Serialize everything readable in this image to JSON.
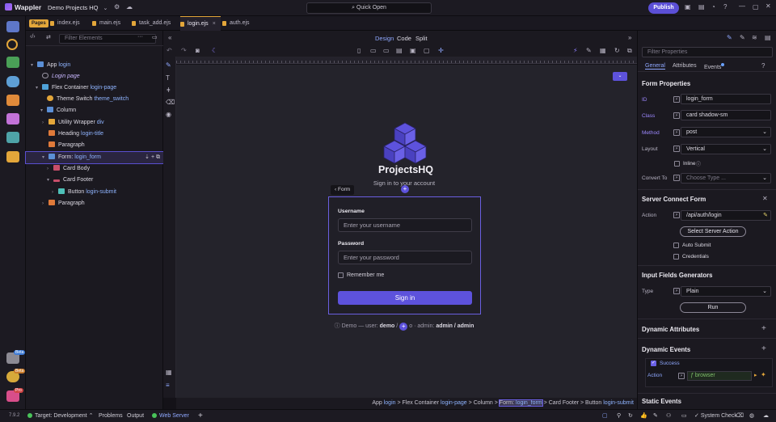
{
  "app": {
    "name": "Wappler",
    "project": "Demo Projects HQ",
    "quick_open": "Quick Open",
    "publish": "Publish"
  },
  "tabs": {
    "pages_badge": "Pages",
    "items": [
      "index.ejs",
      "main.ejs",
      "task_add.ejs",
      "login.ejs",
      "auth.ejs"
    ],
    "active": "login.ejs"
  },
  "rail_badges": {
    "beta": "Beta",
    "pro": "Pro"
  },
  "tree": {
    "filter_placeholder": "Filter Elements",
    "nodes": [
      {
        "label": "App",
        "sub": "login"
      },
      {
        "label": "Login page",
        "sub": ""
      },
      {
        "label": "Flex Container",
        "sub": "login-page"
      },
      {
        "label": "Theme Switch",
        "sub": "theme_switch"
      },
      {
        "label": "Column",
        "sub": ""
      },
      {
        "label": "Utility Wrapper",
        "sub": "div"
      },
      {
        "label": "Heading",
        "sub": "login-title"
      },
      {
        "label": "Paragraph",
        "sub": ""
      },
      {
        "label": "Form:",
        "sub": "login_form"
      },
      {
        "label": "Card Body",
        "sub": ""
      },
      {
        "label": "Card Footer",
        "sub": ""
      },
      {
        "label": "Button",
        "sub": "login-submit"
      },
      {
        "label": "Paragraph",
        "sub": ""
      }
    ]
  },
  "views": {
    "design": "Design",
    "code": "Code",
    "split": "Split"
  },
  "canvas": {
    "brand": "ProjectsHQ",
    "tagline": "Sign in to your account",
    "form_label": "Form",
    "username_label": "Username",
    "username_placeholder": "Enter your username",
    "password_label": "Password",
    "password_placeholder": "Enter your password",
    "remember": "Remember me",
    "signin": "Sign in",
    "demo_prefix": "Demo — user:",
    "demo_user": "demo",
    "demo_mid": "/",
    "demo_tail": "o · admin:",
    "demo_admin": "admin / admin"
  },
  "breadcrumb": [
    {
      "label": "App",
      "sub": "login"
    },
    {
      "label": "Flex Container",
      "sub": "login-page"
    },
    {
      "label": "Column",
      "sub": ""
    },
    {
      "label": "Form:",
      "sub": "login_form"
    },
    {
      "label": "Card Footer",
      "sub": ""
    },
    {
      "label": "Button",
      "sub": "login-submit"
    }
  ],
  "props": {
    "filter_placeholder": "Filter Properties",
    "tabs": [
      "General",
      "Attributes",
      "Events"
    ],
    "form_properties": "Form Properties",
    "id_label": "ID",
    "id_value": "login_form",
    "class_label": "Class",
    "class_value": "card shadow-sm",
    "method_label": "Method",
    "method_value": "post",
    "layout_label": "Layout",
    "layout_value": "Vertical",
    "inline_label": "Inline",
    "convert_label": "Convert To",
    "convert_placeholder": "Choose Type ...",
    "scf_title": "Server Connect Form",
    "action_label": "Action",
    "action_value": "/api/auth/login",
    "select_action": "Select Server Action",
    "auto_submit": "Auto Submit",
    "credentials": "Credentials",
    "ifg_title": "Input Fields Generators",
    "type_label": "Type",
    "type_value": "Plain",
    "run": "Run",
    "dyn_attrs": "Dynamic Attributes",
    "dyn_events": "Dynamic Events",
    "success": "Success",
    "event_action_label": "Action",
    "event_action_value": "browser",
    "static_events": "Static Events"
  },
  "status": {
    "version": "7.9.2",
    "target": "Target:",
    "target_value": "Development",
    "problems": "Problems",
    "output": "Output",
    "web_server": "Web Server",
    "system_check": "System Check"
  },
  "colors": {
    "accent": "#5d52dc",
    "tab_active": "#e3a63a",
    "link": "#8fb4ff"
  }
}
